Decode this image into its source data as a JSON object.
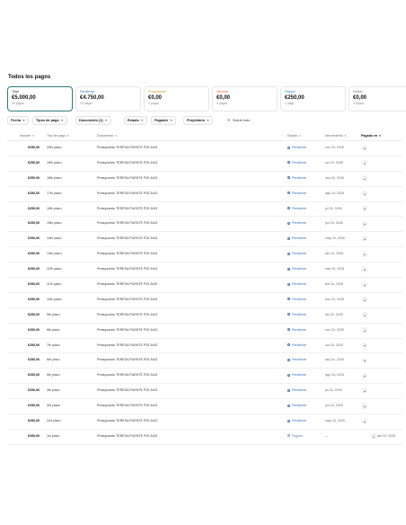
{
  "page": {
    "title": "Todos los pagos"
  },
  "cards": [
    {
      "label": "Total",
      "amount": "€5.000,00",
      "count": "20 pagos",
      "color": "#1f2328",
      "active": true
    },
    {
      "label": "Pendiente",
      "amount": "€4.750,00",
      "count": "19 pagos",
      "color": "#3f6fb5",
      "active": false
    },
    {
      "label": "Programado",
      "amount": "€0,00",
      "count": "0 pagos",
      "color": "#c9a227",
      "active": false
    },
    {
      "label": "Vencido",
      "amount": "€0,00",
      "count": "0 pagos",
      "color": "#e05d3a",
      "active": false
    },
    {
      "label": "Pagado",
      "amount": "€250,00",
      "count": "1 pago",
      "color": "#3f8fd0",
      "active": false
    },
    {
      "label": "Fallido",
      "amount": "€0,00",
      "count": "0 pagos",
      "color": "#777777",
      "active": false
    }
  ],
  "filters": [
    {
      "label": "Fecha"
    },
    {
      "label": "Tipos de pago"
    },
    {
      "label": "Documento (1)"
    },
    {
      "label": "Estado"
    },
    {
      "label": "Pagador"
    },
    {
      "label": "Propietario"
    }
  ],
  "clear_label": "Borrar todo",
  "columns": {
    "amount": "Importe",
    "kind": "Tipo de pago",
    "doc": "Documento",
    "status": "Estado",
    "due": "Vencimiento",
    "paid": "Pagado en"
  },
  "rows": [
    {
      "amount": "€250,00",
      "kind": "20th plazo",
      "doc": "Presupuesto TERESA PUENTE P25 3443",
      "status": "Pendiente",
      "due": "nov 24, 2026",
      "paid": ""
    },
    {
      "amount": "€250,00",
      "kind": "19th plazo",
      "doc": "Presupuesto TERESA PUENTE P25 3443",
      "status": "Pendiente",
      "due": "oct 24, 2026",
      "paid": ""
    },
    {
      "amount": "€250,00",
      "kind": "18th plazo",
      "doc": "Presupuesto TERESA PUENTE P25 3443",
      "status": "Pendiente",
      "due": "sep 24, 2026",
      "paid": ""
    },
    {
      "amount": "€250,00",
      "kind": "17th plazo",
      "doc": "Presupuesto TERESA PUENTE P25 3443",
      "status": "Pendiente",
      "due": "ago 24, 2026",
      "paid": ""
    },
    {
      "amount": "€250,00",
      "kind": "16th plazo",
      "doc": "Presupuesto TERESA PUENTE P25 3443",
      "status": "Pendiente",
      "due": "jul 24, 2026",
      "paid": ""
    },
    {
      "amount": "€250,00",
      "kind": "15th plazo",
      "doc": "Presupuesto TERESA PUENTE P25 3443",
      "status": "Pendiente",
      "due": "jun 24, 2026",
      "paid": ""
    },
    {
      "amount": "€250,00",
      "kind": "14th plazo",
      "doc": "Presupuesto TERESA PUENTE P25 3443",
      "status": "Pendiente",
      "due": "may 24, 2026",
      "paid": ""
    },
    {
      "amount": "€250,00",
      "kind": "13th plazo",
      "doc": "Presupuesto TERESA PUENTE P25 3443",
      "status": "Pendiente",
      "due": "abr 24, 2026",
      "paid": ""
    },
    {
      "amount": "€250,00",
      "kind": "12th plazo",
      "doc": "Presupuesto TERESA PUENTE P25 3443",
      "status": "Pendiente",
      "due": "mar 24, 2026",
      "paid": ""
    },
    {
      "amount": "€250,00",
      "kind": "11th plazo",
      "doc": "Presupuesto TERESA PUENTE P25 3443",
      "status": "Pendiente",
      "due": "feb 24, 2026",
      "paid": ""
    },
    {
      "amount": "€250,00",
      "kind": "10th plazo",
      "doc": "Presupuesto TERESA PUENTE P25 3443",
      "status": "Pendiente",
      "due": "ene 24, 2026",
      "paid": ""
    },
    {
      "amount": "€250,00",
      "kind": "9th plazo",
      "doc": "Presupuesto TERESA PUENTE P25 3443",
      "status": "Pendiente",
      "due": "dic 24, 2025",
      "paid": ""
    },
    {
      "amount": "€250,00",
      "kind": "8th plazo",
      "doc": "Presupuesto TERESA PUENTE P25 3443",
      "status": "Pendiente",
      "due": "nov 24, 2025",
      "paid": ""
    },
    {
      "amount": "€250,00",
      "kind": "7th plazo",
      "doc": "Presupuesto TERESA PUENTE P25 3443",
      "status": "Pendiente",
      "due": "oct 24, 2025",
      "paid": ""
    },
    {
      "amount": "€250,00",
      "kind": "6th plazo",
      "doc": "Presupuesto TERESA PUENTE P25 3443",
      "status": "Pendiente",
      "due": "sep 24, 2025",
      "paid": ""
    },
    {
      "amount": "€250,00",
      "kind": "5th plazo",
      "doc": "Presupuesto TERESA PUENTE P25 3443",
      "status": "Pendiente",
      "due": "ago 24, 2025",
      "paid": ""
    },
    {
      "amount": "€250,00",
      "kind": "4th plazo",
      "doc": "Presupuesto TERESA PUENTE P25 3443",
      "status": "Pendiente",
      "due": "jul 24, 2025",
      "paid": ""
    },
    {
      "amount": "€250,00",
      "kind": "3rd plazo",
      "doc": "Presupuesto TERESA PUENTE P25 3443",
      "status": "Pendiente",
      "due": "jun 24, 2025",
      "paid": ""
    },
    {
      "amount": "€250,00",
      "kind": "2nd plazo",
      "doc": "Presupuesto TERESA PUENTE P25 3443",
      "status": "Pendiente",
      "due": "may 24, 2025",
      "paid": ""
    },
    {
      "amount": "€250,00",
      "kind": "1st plazo",
      "doc": "Presupuesto TERESA PUENTE P25 3443",
      "status": "Pagado",
      "due": "—",
      "paid": "abr 24, 2025"
    }
  ]
}
